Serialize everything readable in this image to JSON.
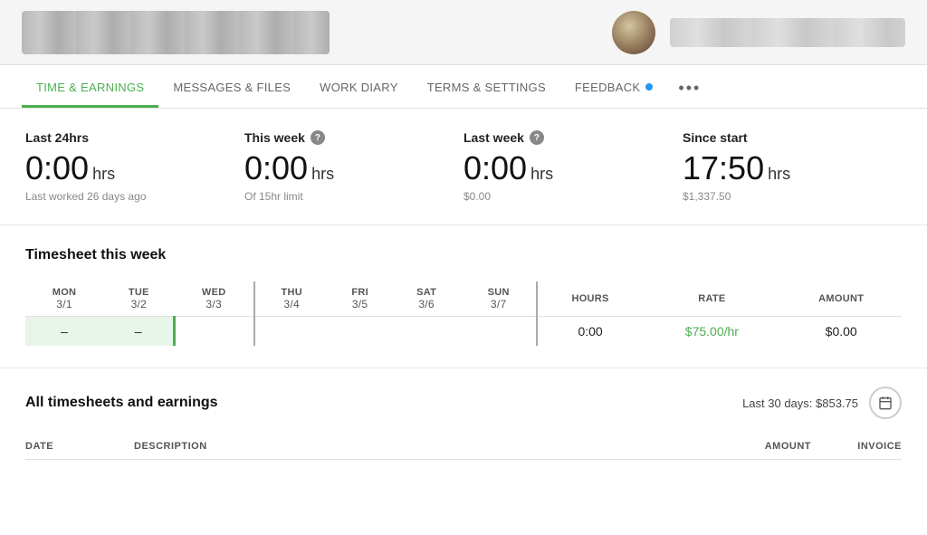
{
  "header": {
    "tabs": [
      {
        "id": "time-earnings",
        "label": "TIME & EARNINGS",
        "active": true
      },
      {
        "id": "messages-files",
        "label": "MESSAGES & FILES",
        "active": false
      },
      {
        "id": "work-diary",
        "label": "WORK DIARY",
        "active": false
      },
      {
        "id": "terms-settings",
        "label": "TERMS & SETTINGS",
        "active": false
      },
      {
        "id": "feedback",
        "label": "FEEDBACK",
        "active": false
      }
    ],
    "more_label": "•••"
  },
  "stats": {
    "last24": {
      "label": "Last 24hrs",
      "value": "0:00",
      "unit": "hrs",
      "sub": "Last worked 26 days ago"
    },
    "this_week": {
      "label": "This week",
      "value": "0:00",
      "unit": "hrs",
      "sub": "Of 15hr limit",
      "has_help": true
    },
    "last_week": {
      "label": "Last week",
      "value": "0:00",
      "unit": "hrs",
      "sub": "$0.00",
      "has_help": true
    },
    "since_start": {
      "label": "Since start",
      "value": "17:50",
      "unit": "hrs",
      "sub": "$1,337.50"
    }
  },
  "timesheet": {
    "title": "Timesheet this week",
    "days": [
      {
        "day": "MON",
        "date": "3/1",
        "value": "–",
        "type": "green"
      },
      {
        "day": "TUE",
        "date": "3/2",
        "value": "–",
        "type": "green"
      },
      {
        "day": "WED",
        "date": "3/3",
        "value": "",
        "type": "current"
      },
      {
        "day": "THU",
        "date": "3/4",
        "value": "",
        "type": "empty"
      },
      {
        "day": "FRI",
        "date": "3/5",
        "value": "",
        "type": "empty"
      },
      {
        "day": "SAT",
        "date": "3/6",
        "value": "",
        "type": "empty"
      },
      {
        "day": "SUN",
        "date": "3/7",
        "value": "",
        "type": "empty"
      }
    ],
    "cols": {
      "hours_label": "HOURS",
      "rate_label": "RATE",
      "amount_label": "AMOUNT"
    },
    "row": {
      "hours": "0:00",
      "rate": "$75.00/hr",
      "amount": "$0.00"
    }
  },
  "all_timesheets": {
    "title": "All timesheets and earnings",
    "last30_text": "Last 30 days: $853.75",
    "columns": {
      "date": "DATE",
      "description": "DESCRIPTION",
      "amount": "AMOUNT",
      "invoice": "INVOICE"
    }
  }
}
